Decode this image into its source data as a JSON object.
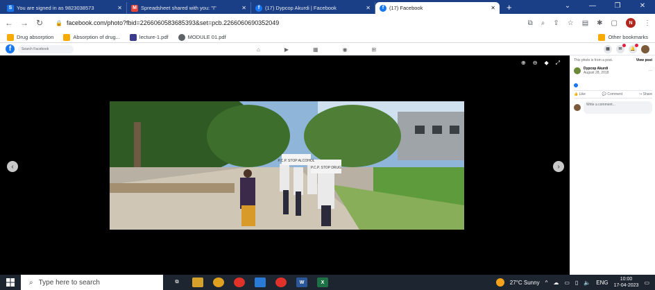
{
  "tabs": [
    {
      "title": "You are signed in as 9823038573",
      "icon": "S",
      "color": "#1a73e8"
    },
    {
      "title": "Spreadsheet shared with you: \"I\"",
      "icon": "M",
      "color": "#ea4335"
    },
    {
      "title": "(17) Dypcop Akurdi | Facebook",
      "icon": "f",
      "color": "#1877f2"
    },
    {
      "title": "(17) Facebook",
      "icon": "f",
      "color": "#1877f2",
      "active": true
    }
  ],
  "address": {
    "url": "facebook.com/photo?fbid=2266060583685393&set=pcb.2266060690352049"
  },
  "bookmarks": [
    "Drug absorption",
    "Absorption of drug...",
    "lecture-1.pdf",
    "MODULE 01.pdf"
  ],
  "bookmarks_other": "Other bookmarks",
  "fb": {
    "search_placeholder": "Search Facebook",
    "user_initial": "N"
  },
  "side": {
    "header": "This photo is from a post.",
    "view_post": "View post",
    "page_name": "Dypcop Akurdi",
    "date": "August 28, 2018",
    "like": "Like",
    "comment": "Comment",
    "share": "Share",
    "comment_placeholder": "Write a comment..."
  },
  "taskbar": {
    "search": "Type here to search",
    "temp": "27°C Sunny",
    "lang": "ENG",
    "time": "10:00",
    "date": "17-04-2023"
  },
  "photo": {
    "sign1": "P.C.P. STOP ALCOHOL",
    "sign2": "P.C.P. STOP DRUG"
  }
}
